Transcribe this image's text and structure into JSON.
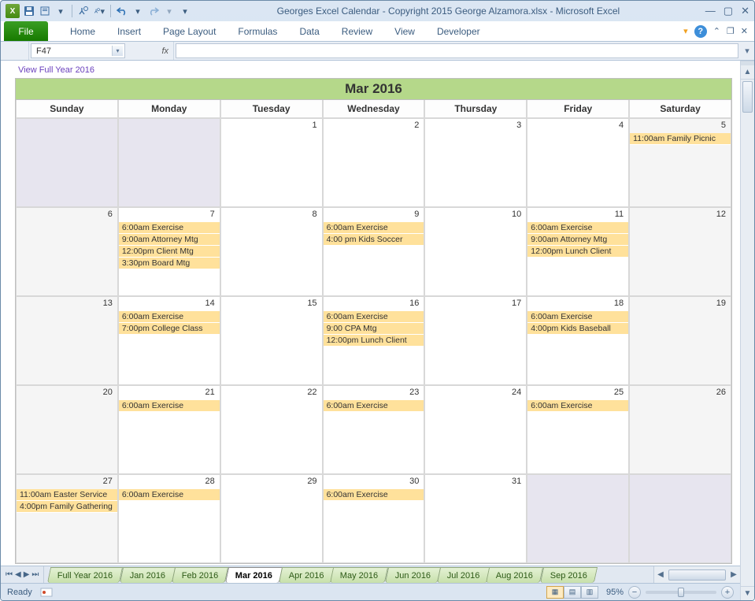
{
  "title": "Georges Excel Calendar - Copyright 2015 George Alzamora.xlsx  -  Microsoft Excel",
  "ribbon": {
    "file": "File",
    "tabs": [
      "Home",
      "Insert",
      "Page Layout",
      "Formulas",
      "Data",
      "Review",
      "View",
      "Developer"
    ]
  },
  "namebox": "F47",
  "fx_label": "fx",
  "viewlink": "View Full Year 2016",
  "calendar": {
    "title": "Mar 2016",
    "dayheads": [
      "Sunday",
      "Monday",
      "Tuesday",
      "Wednesday",
      "Thursday",
      "Friday",
      "Saturday"
    ],
    "cells": [
      {
        "off": true
      },
      {
        "off": true
      },
      {
        "num": "1"
      },
      {
        "num": "2"
      },
      {
        "num": "3"
      },
      {
        "num": "4"
      },
      {
        "num": "5",
        "wknd": true,
        "events": [
          "11:00am Family Picnic"
        ]
      },
      {
        "num": "6",
        "wknd": true
      },
      {
        "num": "7",
        "events": [
          "6:00am Exercise",
          "9:00am Attorney Mtg",
          "12:00pm Client Mtg",
          "3:30pm Board Mtg"
        ]
      },
      {
        "num": "8"
      },
      {
        "num": "9",
        "events": [
          "6:00am Exercise",
          "4:00 pm Kids Soccer"
        ]
      },
      {
        "num": "10"
      },
      {
        "num": "11",
        "events": [
          "6:00am Exercise",
          "9:00am Attorney Mtg",
          "12:00pm Lunch Client"
        ]
      },
      {
        "num": "12",
        "wknd": true
      },
      {
        "num": "13",
        "wknd": true
      },
      {
        "num": "14",
        "events": [
          "6:00am Exercise",
          "7:00pm College Class"
        ]
      },
      {
        "num": "15"
      },
      {
        "num": "16",
        "events": [
          "6:00am Exercise",
          "9:00 CPA Mtg",
          "12:00pm Lunch Client"
        ]
      },
      {
        "num": "17"
      },
      {
        "num": "18",
        "events": [
          "6:00am Exercise",
          "4:00pm Kids Baseball"
        ]
      },
      {
        "num": "19",
        "wknd": true
      },
      {
        "num": "20",
        "wknd": true
      },
      {
        "num": "21",
        "events": [
          "6:00am Exercise"
        ]
      },
      {
        "num": "22"
      },
      {
        "num": "23",
        "events": [
          "6:00am Exercise"
        ]
      },
      {
        "num": "24"
      },
      {
        "num": "25",
        "events": [
          "6:00am Exercise"
        ]
      },
      {
        "num": "26",
        "wknd": true
      },
      {
        "num": "27",
        "wknd": true,
        "events": [
          "11:00am Easter Service",
          "4:00pm Family Gathering"
        ]
      },
      {
        "num": "28",
        "events": [
          "6:00am Exercise"
        ]
      },
      {
        "num": "29"
      },
      {
        "num": "30",
        "events": [
          "6:00am Exercise"
        ]
      },
      {
        "num": "31"
      },
      {
        "off": true
      },
      {
        "off": true
      }
    ]
  },
  "sheet_tabs": {
    "scroll_last_visible": "Sep 2016",
    "list": [
      {
        "label": "Full Year 2016"
      },
      {
        "label": "Jan 2016"
      },
      {
        "label": "Feb 2016"
      },
      {
        "label": "Mar 2016",
        "active": true
      },
      {
        "label": "Apr 2016"
      },
      {
        "label": "May 2016"
      },
      {
        "label": "Jun 2016"
      },
      {
        "label": "Jul 2016"
      },
      {
        "label": "Aug 2016"
      },
      {
        "label": "Sep 2016"
      }
    ]
  },
  "status": {
    "ready": "Ready",
    "zoom": "95%"
  }
}
